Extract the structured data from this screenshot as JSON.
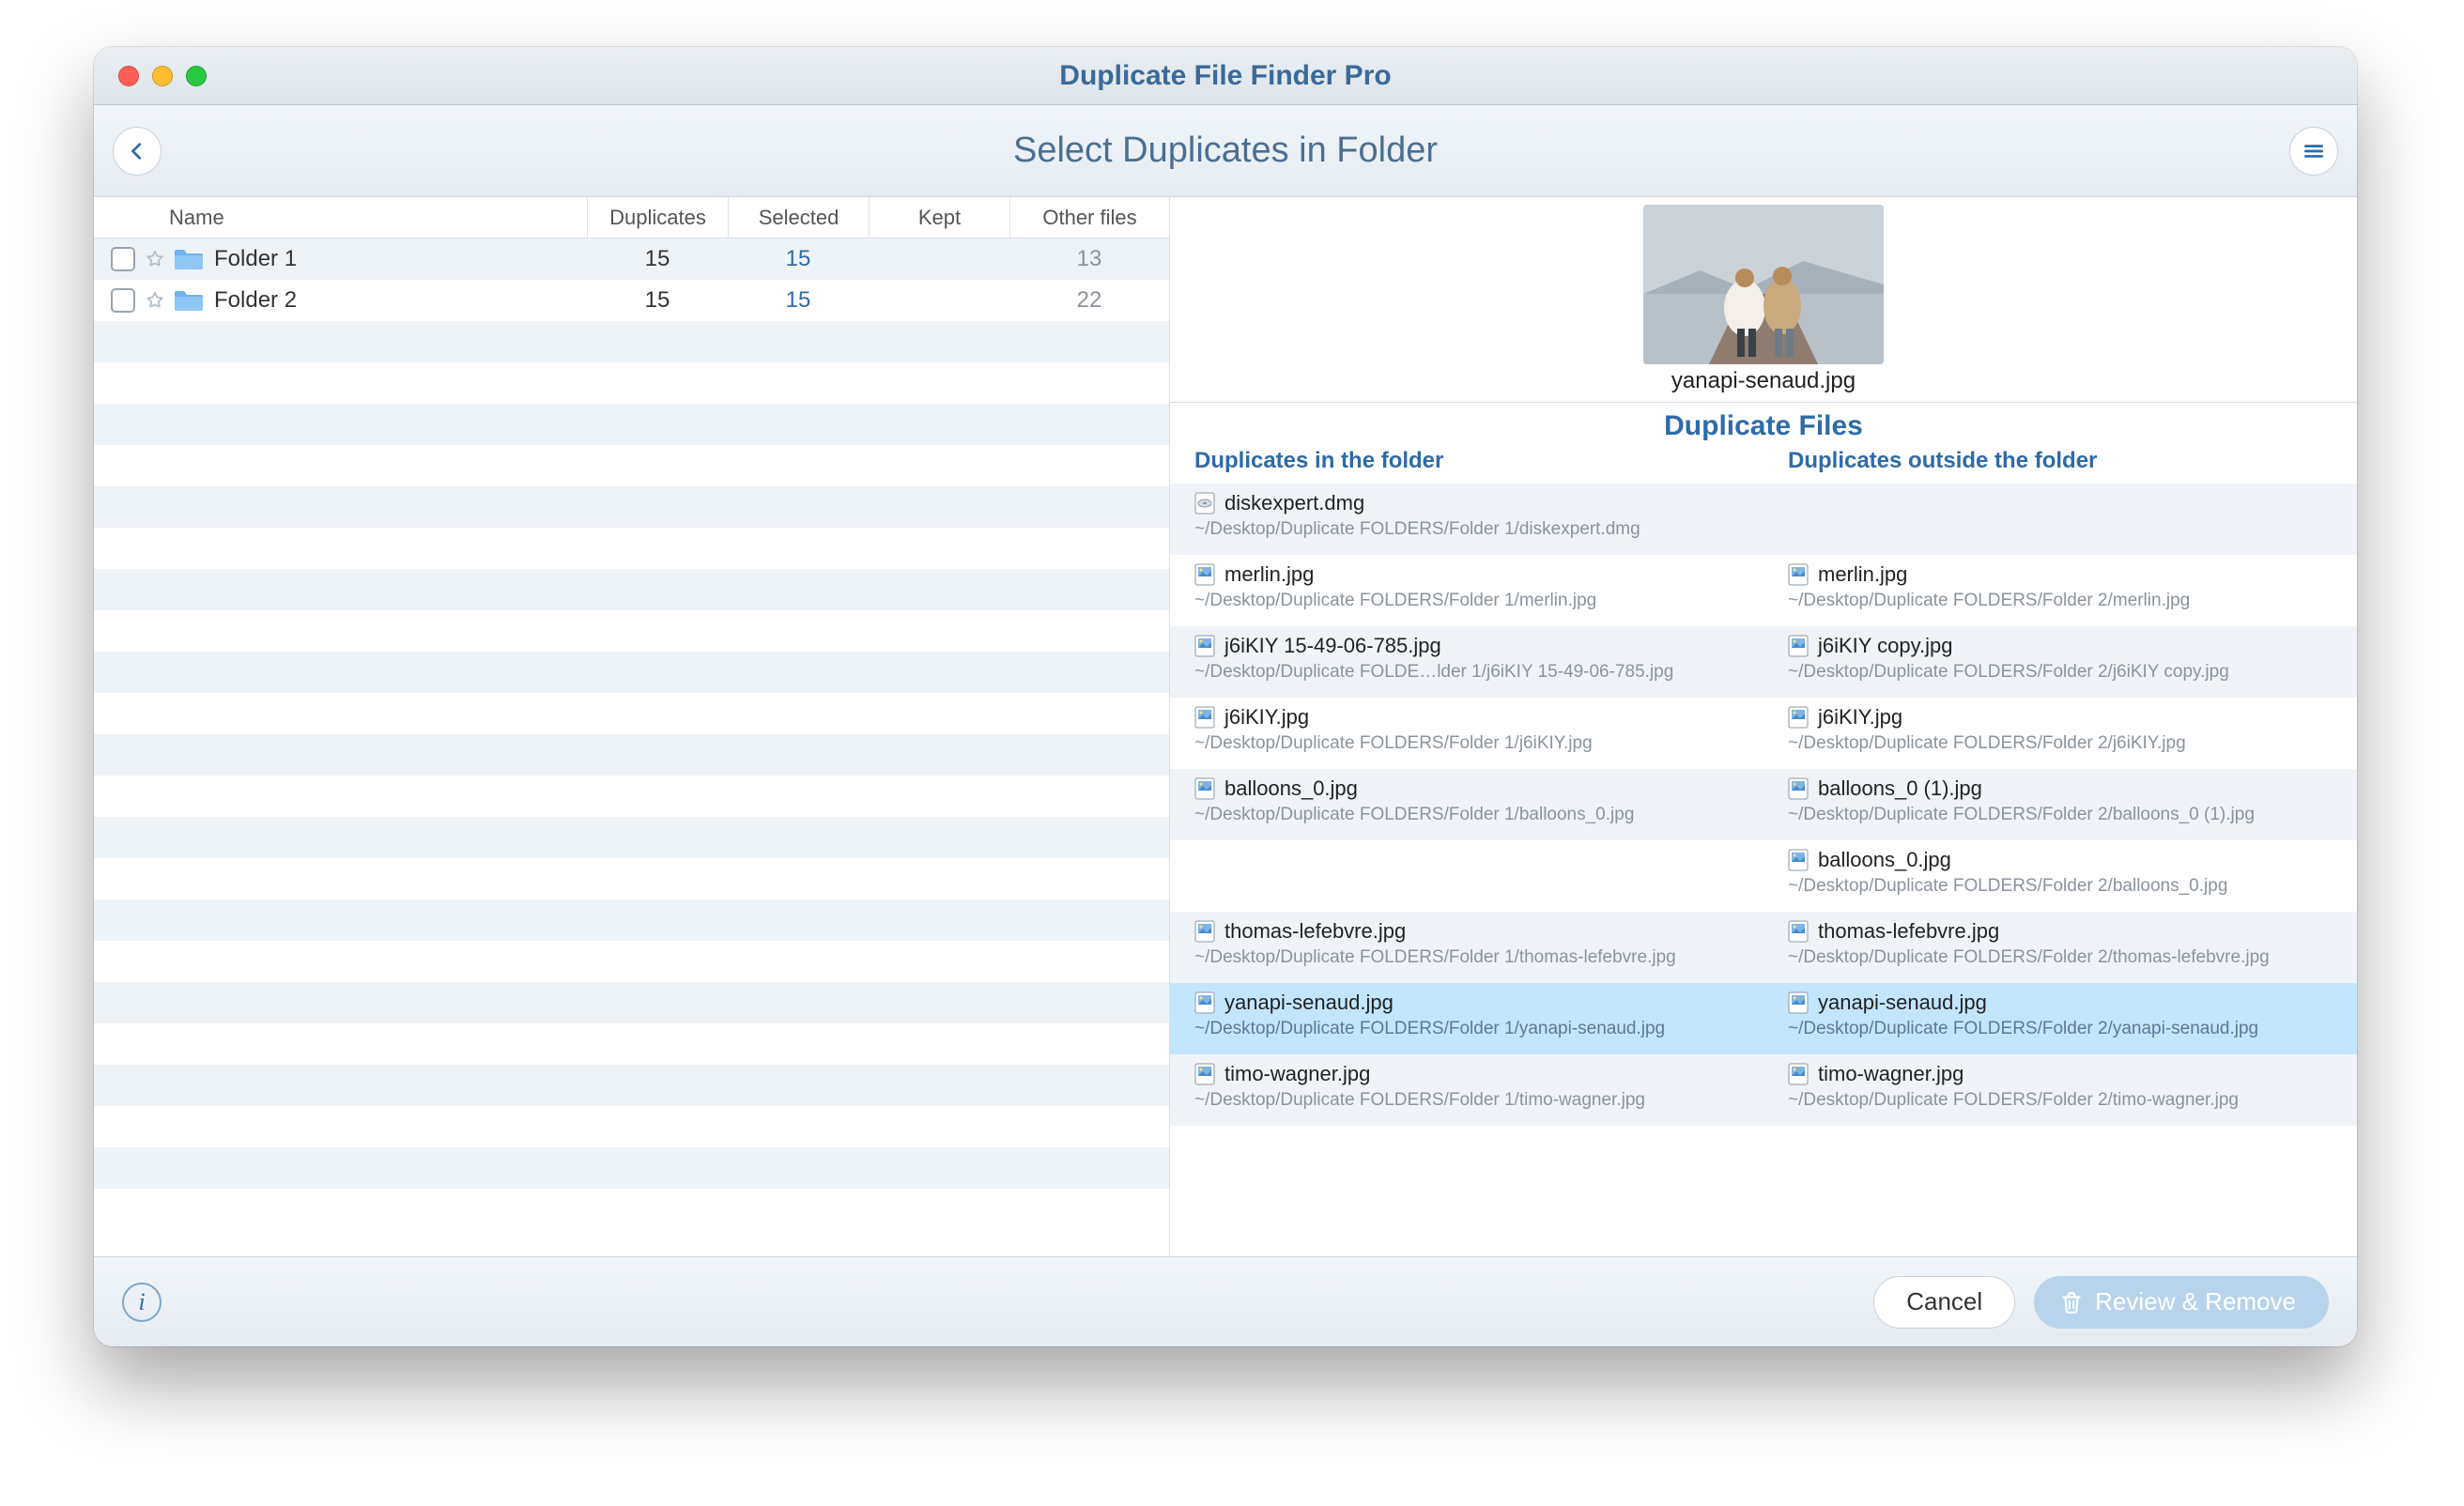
{
  "app_title": "Duplicate File Finder Pro",
  "subtitle": "Select Duplicates in Folder",
  "left": {
    "columns": {
      "name": "Name",
      "duplicates": "Duplicates",
      "selected": "Selected",
      "kept": "Kept",
      "other": "Other files"
    },
    "folders": [
      {
        "name": "Folder 1",
        "duplicates": "15",
        "selected": "15",
        "kept": "",
        "other": "13"
      },
      {
        "name": "Folder 2",
        "duplicates": "15",
        "selected": "15",
        "kept": "",
        "other": "22"
      }
    ]
  },
  "preview": {
    "filename": "yanapi-senaud.jpg"
  },
  "right": {
    "heading": "Duplicate Files",
    "col_in": "Duplicates in the folder",
    "col_out": "Duplicates outside the folder",
    "rows": [
      {
        "selected": false,
        "in": {
          "name": "diskexpert.dmg",
          "path": "~/Desktop/Duplicate FOLDERS/Folder 1/diskexpert.dmg",
          "kind": "dmg"
        },
        "out": null
      },
      {
        "selected": false,
        "in": {
          "name": "merlin.jpg",
          "path": "~/Desktop/Duplicate FOLDERS/Folder 1/merlin.jpg",
          "kind": "img"
        },
        "out": {
          "name": "merlin.jpg",
          "path": "~/Desktop/Duplicate FOLDERS/Folder 2/merlin.jpg",
          "kind": "img"
        }
      },
      {
        "selected": false,
        "in": {
          "name": "j6iKIY 15-49-06-785.jpg",
          "path": "~/Desktop/Duplicate FOLDE…lder 1/j6iKIY 15-49-06-785.jpg",
          "kind": "img"
        },
        "out": {
          "name": "j6iKIY copy.jpg",
          "path": "~/Desktop/Duplicate FOLDERS/Folder 2/j6iKIY copy.jpg",
          "kind": "img"
        }
      },
      {
        "selected": false,
        "in": {
          "name": "j6iKIY.jpg",
          "path": "~/Desktop/Duplicate FOLDERS/Folder 1/j6iKIY.jpg",
          "kind": "img"
        },
        "out": {
          "name": "j6iKIY.jpg",
          "path": "~/Desktop/Duplicate FOLDERS/Folder 2/j6iKIY.jpg",
          "kind": "img"
        }
      },
      {
        "selected": false,
        "in": {
          "name": "balloons_0.jpg",
          "path": "~/Desktop/Duplicate FOLDERS/Folder 1/balloons_0.jpg",
          "kind": "img"
        },
        "out": {
          "name": "balloons_0 (1).jpg",
          "path": "~/Desktop/Duplicate FOLDERS/Folder 2/balloons_0 (1).jpg",
          "kind": "img"
        }
      },
      {
        "selected": false,
        "in": null,
        "out": {
          "name": "balloons_0.jpg",
          "path": "~/Desktop/Duplicate FOLDERS/Folder 2/balloons_0.jpg",
          "kind": "img"
        }
      },
      {
        "selected": false,
        "in": {
          "name": "thomas-lefebvre.jpg",
          "path": "~/Desktop/Duplicate FOLDERS/Folder 1/thomas-lefebvre.jpg",
          "kind": "img"
        },
        "out": {
          "name": "thomas-lefebvre.jpg",
          "path": "~/Desktop/Duplicate FOLDERS/Folder 2/thomas-lefebvre.jpg",
          "kind": "img"
        }
      },
      {
        "selected": true,
        "in": {
          "name": "yanapi-senaud.jpg",
          "path": "~/Desktop/Duplicate FOLDERS/Folder 1/yanapi-senaud.jpg",
          "kind": "img"
        },
        "out": {
          "name": "yanapi-senaud.jpg",
          "path": "~/Desktop/Duplicate FOLDERS/Folder 2/yanapi-senaud.jpg",
          "kind": "img"
        }
      },
      {
        "selected": false,
        "in": {
          "name": "timo-wagner.jpg",
          "path": "~/Desktop/Duplicate FOLDERS/Folder 1/timo-wagner.jpg",
          "kind": "img"
        },
        "out": {
          "name": "timo-wagner.jpg",
          "path": "~/Desktop/Duplicate FOLDERS/Folder 2/timo-wagner.jpg",
          "kind": "img"
        }
      }
    ]
  },
  "footer": {
    "cancel": "Cancel",
    "review": "Review & Remove"
  }
}
